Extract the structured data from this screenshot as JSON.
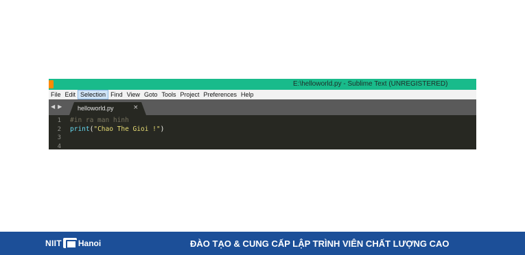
{
  "window": {
    "title": "E:\\helloworld.py - Sublime Text (UNREGISTERED)",
    "menu": [
      "File",
      "Edit",
      "Selection",
      "Find",
      "View",
      "Goto",
      "Tools",
      "Project",
      "Preferences",
      "Help"
    ],
    "active_menu": "Selection",
    "tab": {
      "label": "helloworld.py",
      "close": "×"
    },
    "nav": {
      "back": "◀",
      "forward": "▶"
    }
  },
  "editor": {
    "line_numbers": [
      "1",
      "2",
      "3",
      "4"
    ],
    "lines": [
      {
        "comment": "#in ra man hinh"
      },
      {
        "builtin": "print",
        "open": "(",
        "string": "\"Chao The Gioi !\"",
        "close": ")"
      },
      {},
      {}
    ]
  },
  "banner": {
    "logo_text": "NIIT",
    "logo_city": "Hanoi",
    "tagline": "ĐÀO TẠO & CUNG CẤP LẬP TRÌNH VIÊN CHẤT LƯỢNG CAO"
  },
  "colors": {
    "titlebar": "#19bb8b",
    "editor_bg": "#272822",
    "banner_bg": "#1c4f98"
  }
}
